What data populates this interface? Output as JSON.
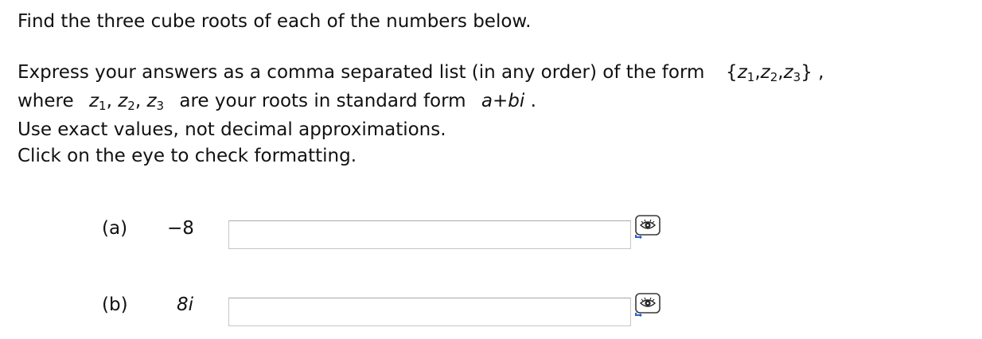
{
  "instructions": {
    "line1": "Find the three cube roots of each of the numbers below.",
    "line2_prefix": "Express your answers as a comma separated list (in any order) of the form",
    "set_open": "{",
    "z": "z",
    "comma": ",",
    "set_close": "}",
    "trailing_comma": ",",
    "sub1": "1",
    "sub2": "2",
    "sub3": "3",
    "where": "where",
    "are_roots": "are your roots in standard form",
    "standard_form": "a+bi",
    "period": ".",
    "line4": "Use exact values, not decimal approximations.",
    "line5": "Click on the eye to check formatting."
  },
  "parts": [
    {
      "label": "(a)",
      "number": "−8",
      "answer_value": ""
    },
    {
      "label": "(b)",
      "number": "8i",
      "answer_value": ""
    }
  ],
  "icons": {
    "preview": "eye-icon"
  }
}
